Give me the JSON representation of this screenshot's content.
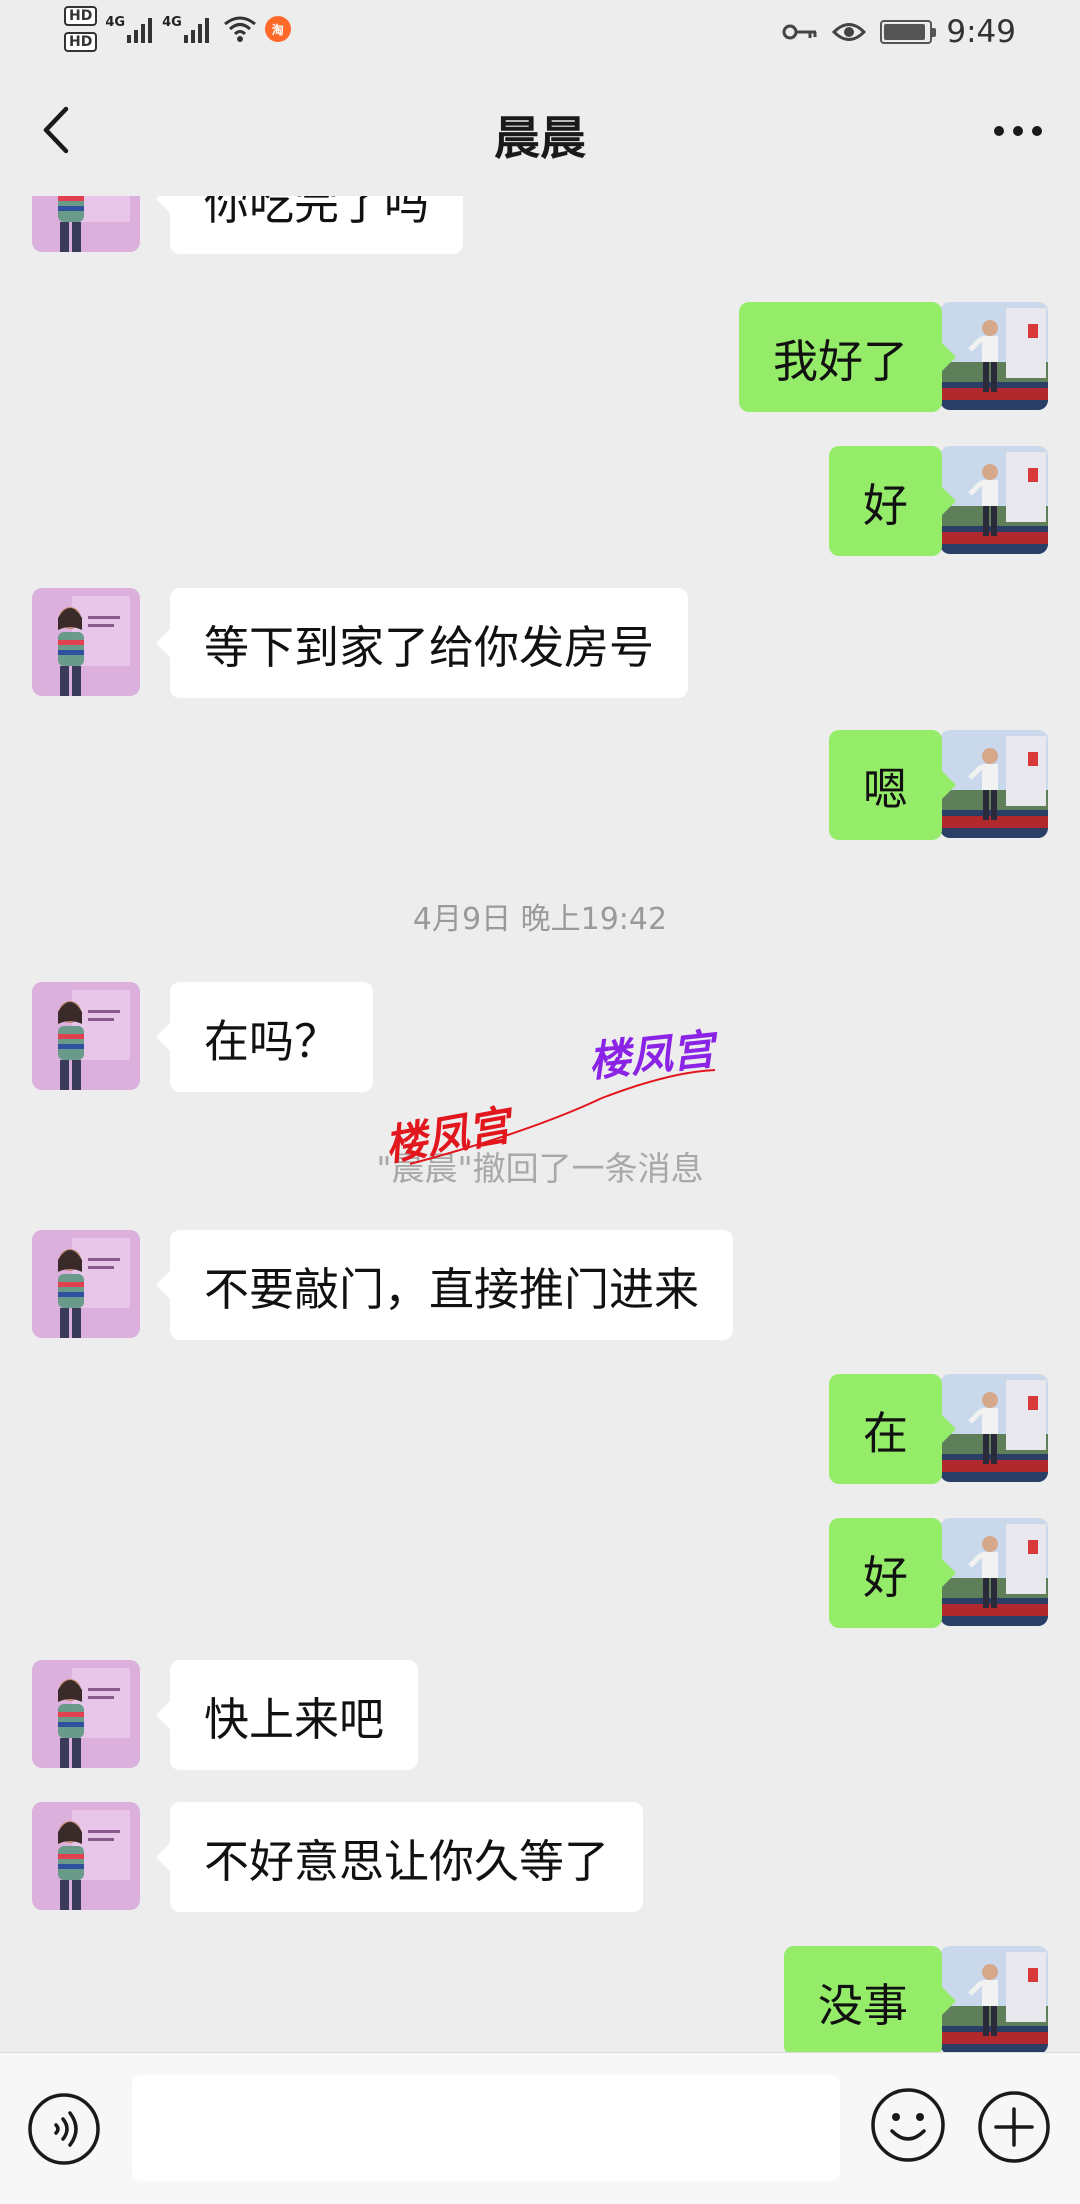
{
  "status_bar": {
    "time": "9:49",
    "network_left": "4G",
    "network_right": "4G",
    "hd_label": "HD"
  },
  "nav": {
    "title": "晨晨"
  },
  "messages": [
    {
      "side": "in",
      "text": "你吃完了吗"
    },
    {
      "side": "out",
      "text": "我好了"
    },
    {
      "side": "out",
      "text": "好"
    },
    {
      "side": "in",
      "text": "等下到家了给你发房号"
    },
    {
      "side": "out",
      "text": "嗯"
    },
    {
      "side": "in",
      "text": "在吗？"
    },
    {
      "side": "in",
      "text": "不要敲门，直接推门进来"
    },
    {
      "side": "out",
      "text": "在"
    },
    {
      "side": "out",
      "text": "好"
    },
    {
      "side": "in",
      "text": "快上来吧"
    },
    {
      "side": "in",
      "text": "不好意思让你久等了"
    },
    {
      "side": "out",
      "text": "没事"
    }
  ],
  "timestamp": "4月9日 晚上19:42",
  "recall_notice": "\"晨晨\"撤回了一条消息",
  "watermark": {
    "text_1": "楼凤宫",
    "text_2": "楼凤宫",
    "color_1": "#e2161d",
    "color_2": "#8a23e6"
  },
  "input": {
    "value": ""
  },
  "colors": {
    "background": "#ededed",
    "outgoing_bubble": "#95ec69",
    "incoming_bubble": "#ffffff"
  },
  "icons": {
    "back": "chevron-left-icon",
    "more": "more-dots-icon",
    "voice": "voice-icon",
    "emoji": "emoji-icon",
    "plus": "plus-icon"
  }
}
